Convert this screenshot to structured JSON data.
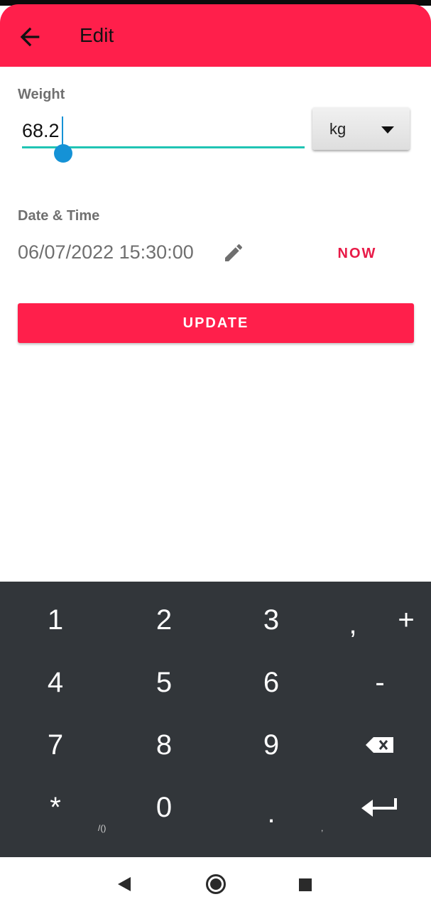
{
  "appbar": {
    "title": "Edit",
    "back_icon": "arrow-left-icon",
    "color": "#ff1f4b"
  },
  "weight": {
    "label": "Weight",
    "value": "68.2",
    "unit_selected": "kg",
    "underline_color": "#20c4b4"
  },
  "datetime": {
    "label": "Date & Time",
    "value": "06/07/2022 15:30:00",
    "edit_icon": "pencil-icon",
    "now_label": "NOW"
  },
  "update_button": {
    "label": "UPDATE"
  },
  "keyboard": {
    "keys": [
      "1",
      "2",
      "3",
      ",",
      "+",
      "4",
      "5",
      "6",
      "-",
      "7",
      "8",
      "9",
      "*",
      "0",
      "."
    ],
    "star_sub": "/()",
    "dot_sub": ",",
    "backspace_icon": "backspace-icon",
    "enter_icon": "enter-icon"
  },
  "navbar": {
    "back_icon": "nav-back-icon",
    "home_icon": "nav-home-icon",
    "recents_icon": "nav-recents-icon"
  }
}
